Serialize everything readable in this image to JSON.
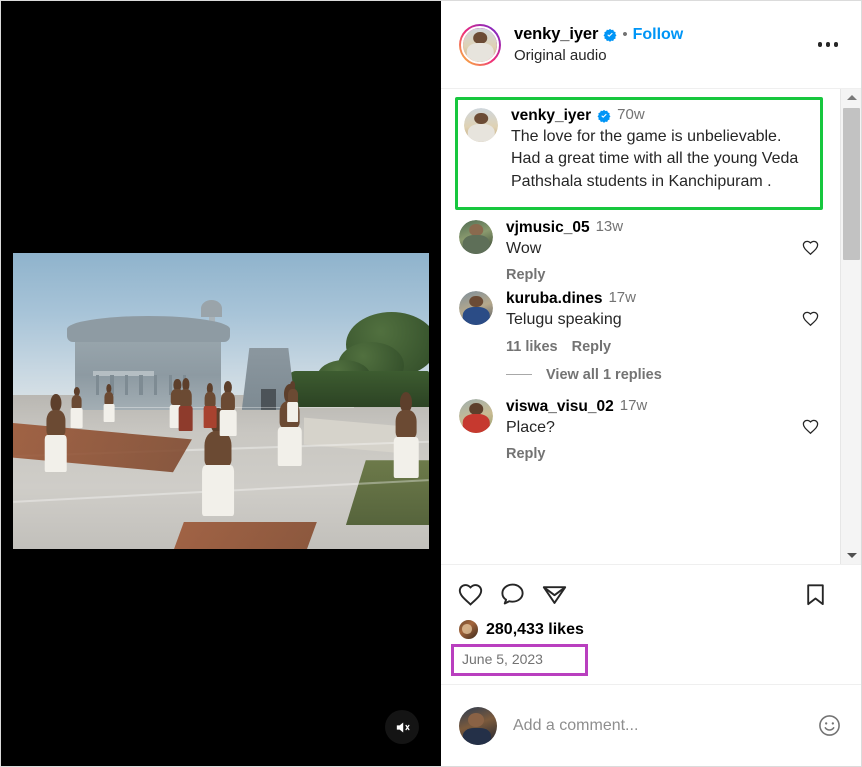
{
  "post": {
    "header": {
      "username": "venky_iyer",
      "verified_icon": "verified-badge-icon",
      "separator": "•",
      "follow_label": "Follow",
      "audio_label": "Original audio",
      "more_icon": "more-options-icon"
    },
    "caption": {
      "username": "venky_iyer",
      "verified_icon": "verified-badge-icon",
      "time": "70w",
      "text": "The love for the game is unbelievable. Had a great time with all the young Veda Pathshala students in Kanchipuram .",
      "highlight_color": "#17c73e"
    },
    "comments": [
      {
        "username": "vjmusic_05",
        "time": "13w",
        "text": "Wow",
        "likes": "",
        "reply_label": "Reply",
        "view_replies": ""
      },
      {
        "username": "kuruba.dines",
        "time": "17w",
        "text": "Telugu speaking",
        "likes": "11 likes",
        "reply_label": "Reply",
        "view_replies": "View all 1 replies"
      },
      {
        "username": "viswa_visu_02",
        "time": "17w",
        "text": "Place?",
        "likes": "",
        "reply_label": "Reply",
        "view_replies": ""
      }
    ],
    "actions": {
      "like_icon": "heart-icon",
      "comment_icon": "comment-bubble-icon",
      "share_icon": "share-paper-plane-icon",
      "save_icon": "bookmark-icon"
    },
    "likes_count": "280,433 likes",
    "date": "June 5, 2023",
    "date_highlight_color": "#b93fbf",
    "add_comment": {
      "placeholder": "Add a comment...",
      "emoji_icon": "emoji-smiley-icon"
    },
    "media": {
      "mute_icon": "muted-speaker-icon",
      "type": "video"
    },
    "scrollbar": {
      "up_icon": "scroll-up-arrow-icon",
      "down_icon": "scroll-down-arrow-icon"
    }
  }
}
